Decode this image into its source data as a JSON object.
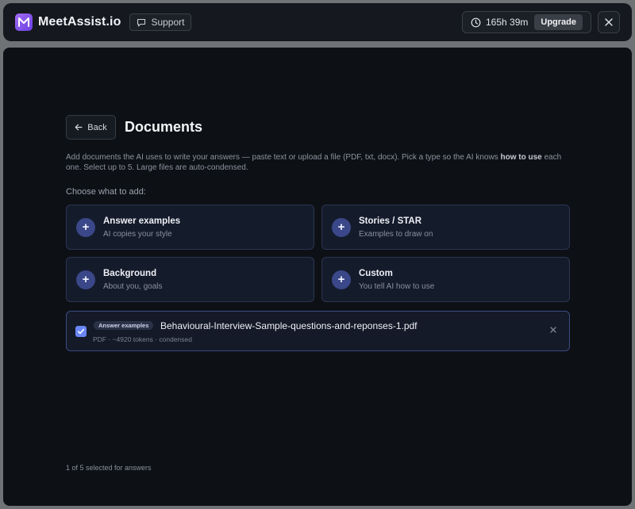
{
  "app": {
    "brand": "MeetAssist.io",
    "support_label": "Support",
    "time_remaining": "165h 39m",
    "upgrade_label": "Upgrade"
  },
  "page": {
    "back_label": "Back",
    "title": "Documents",
    "description_pre": "Add documents the AI uses to write your answers — paste text or upload a file (PDF, txt, docx). Pick a type so the AI knows ",
    "description_bold": "how to use",
    "description_post": " each one. Select up to 5. Large files are auto-condensed.",
    "choose_label": "Choose what to add:"
  },
  "doc_types": [
    {
      "title": "Answer examples",
      "subtitle": "AI copies your style"
    },
    {
      "title": "Stories / STAR",
      "subtitle": "Examples to draw on"
    },
    {
      "title": "Background",
      "subtitle": "About you, goals"
    },
    {
      "title": "Custom",
      "subtitle": "You tell AI how to use"
    }
  ],
  "files": [
    {
      "checked": true,
      "type_badge": "Answer examples",
      "name": "Behavioural-Interview-Sample-questions-and-reponses-1.pdf",
      "meta": "PDF · ~4920 tokens · condensed"
    }
  ],
  "footer": {
    "selection_note": "1 of 5 selected for answers"
  },
  "colors": {
    "accent": "#6a86f5",
    "plus_circle": "#3a4788",
    "card_border": "#2c3552",
    "brand_gradient_start": "#a26cf5",
    "brand_gradient_end": "#6a3ee0"
  },
  "icons": {
    "logo": "m-logo-icon",
    "support": "chat-bubble-icon",
    "timer": "clock-icon",
    "close": "close-icon",
    "back": "arrow-left-icon",
    "add": "plus-icon",
    "checkbox": "checkmark-icon",
    "remove": "close-icon"
  }
}
